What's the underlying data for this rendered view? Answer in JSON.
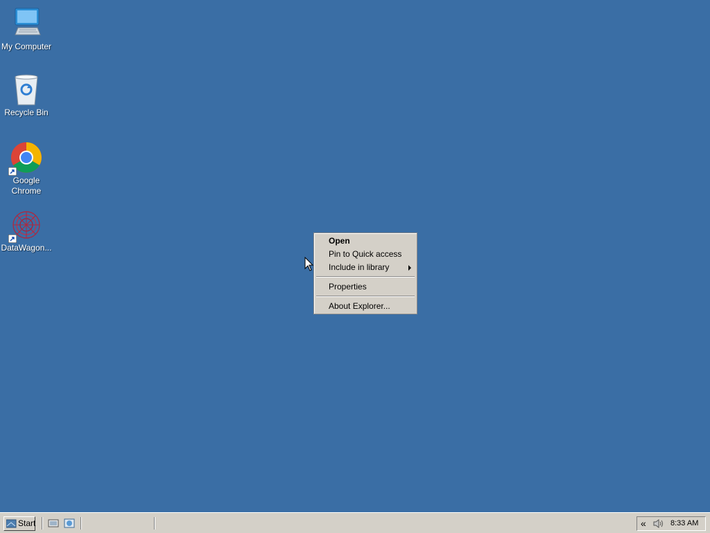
{
  "desktop": {
    "icons": [
      {
        "label": "My Computer",
        "icon": "my-computer-icon"
      },
      {
        "label": "Recycle Bin",
        "icon": "recycle-bin-icon"
      },
      {
        "label": "Google Chrome",
        "icon": "chrome-icon"
      },
      {
        "label": "DataWagon...",
        "icon": "datawagon-icon"
      }
    ]
  },
  "context_menu": {
    "items": [
      {
        "label": "Open",
        "bold": true
      },
      {
        "label": "Pin to Quick access"
      },
      {
        "label": "Include in library",
        "submenu": true
      },
      {
        "label": "Properties"
      },
      {
        "label": "About Explorer..."
      }
    ]
  },
  "taskbar": {
    "start_label": "Start",
    "quick_launch": [
      "show-desktop-icon",
      "explorer-icon"
    ],
    "tray": {
      "expand_glyph": "«",
      "volume_icon": "speaker-icon",
      "clock": "8:33 AM"
    }
  },
  "colors": {
    "desktop": "#3a6ea5",
    "taskbar": "#d4d0c8",
    "menu": "#d4d0c8"
  }
}
